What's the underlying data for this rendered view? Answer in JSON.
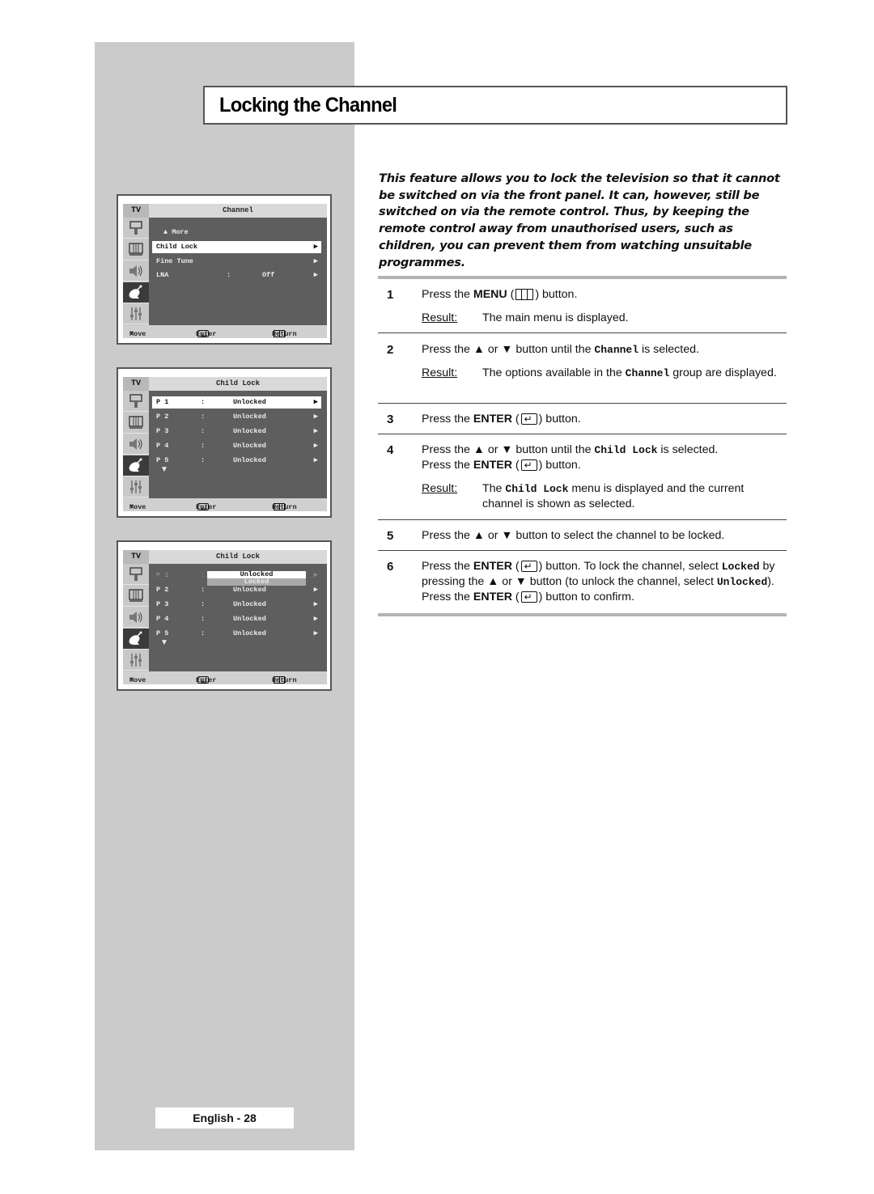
{
  "page": {
    "title": "Locking the Channel",
    "footer": "English - 28",
    "intro": "This feature allows you to lock the television so that it cannot be switched on via the front panel. It can, however, still be switched on via the remote control. Thus, by keeping the remote control away from unauthorised users, such as children, you can prevent them from watching unsuitable programmes."
  },
  "osd_common": {
    "tv_label": "TV",
    "footer_move": "Move",
    "footer_enter": "Enter",
    "footer_return": "Return",
    "icons": [
      "input-icon",
      "picture-icon",
      "sound-icon",
      "channel-icon",
      "setup-icon"
    ],
    "active_icon_index": 3
  },
  "osd_screens": [
    {
      "header": "Channel",
      "more_label": "More",
      "rows": [
        {
          "label": "Child Lock",
          "sep": "",
          "value": "",
          "state": "selected"
        },
        {
          "label": "Fine Tune",
          "sep": "",
          "value": "",
          "state": "normal"
        },
        {
          "label": "LNA",
          "sep": ":",
          "value": "Off",
          "state": "normal"
        }
      ]
    },
    {
      "header": "Child Lock",
      "rows": [
        {
          "label": "P 1",
          "sep": ":",
          "value": "Unlocked",
          "state": "selected"
        },
        {
          "label": "P 2",
          "sep": ":",
          "value": "Unlocked",
          "state": "normal"
        },
        {
          "label": "P 3",
          "sep": ":",
          "value": "Unlocked",
          "state": "normal"
        },
        {
          "label": "P 4",
          "sep": ":",
          "value": "Unlocked",
          "state": "normal"
        },
        {
          "label": "P 5",
          "sep": ":",
          "value": "Unlocked",
          "state": "normal"
        }
      ]
    },
    {
      "header": "Child Lock",
      "rows": [
        {
          "label": "P 1",
          "sep": ":",
          "value": "",
          "state": "dim"
        },
        {
          "label": "P 2",
          "sep": ":",
          "value": "Unlocked",
          "state": "normal"
        },
        {
          "label": "P 3",
          "sep": ":",
          "value": "Unlocked",
          "state": "normal"
        },
        {
          "label": "P 4",
          "sep": ":",
          "value": "Unlocked",
          "state": "normal"
        },
        {
          "label": "P 5",
          "sep": ":",
          "value": "Unlocked",
          "state": "normal"
        }
      ],
      "popup_options": [
        "Unlocked",
        "Locked"
      ],
      "popup_selected": "Unlocked"
    }
  ],
  "steps": [
    {
      "num": "1",
      "parts": [
        "Press the ",
        "MENU",
        " (",
        "menu-icon",
        ")  button."
      ],
      "result": "The main menu is displayed."
    },
    {
      "num": "2",
      "parts": [
        "Press the ▲ or ▼ button until the ",
        "Channel",
        " is selected."
      ],
      "result_parts": [
        "The options available in the ",
        "Channel",
        " group are displayed."
      ]
    },
    {
      "num": "3",
      "parts": [
        "Press the ",
        "ENTER",
        " (",
        "enter-icon",
        ") button."
      ]
    },
    {
      "num": "4",
      "parts": [
        "Press the ▲ or ▼ button until the ",
        "Child Lock",
        " is selected.",
        "Press the ",
        "ENTER",
        " (",
        "enter-icon",
        ") button."
      ],
      "result_parts": [
        "The ",
        "Child Lock",
        " menu is displayed and the current channel is shown as selected."
      ]
    },
    {
      "num": "5",
      "parts": [
        "Press the ▲ or ▼ button to select the channel to be locked."
      ]
    },
    {
      "num": "6",
      "parts": [
        "Press the ",
        "ENTER",
        " (",
        "enter-icon",
        ") button. To lock the channel, select ",
        "Locked",
        " by pressing the ▲ or ▼ button (to unlock the channel, select ",
        "Unlocked",
        "). Press the ",
        "ENTER",
        " (",
        "enter-icon",
        ") button to confirm."
      ]
    }
  ],
  "result_label": "Result:",
  "glyphs": {
    "up": "▲",
    "down": "▼",
    "right": "▶",
    "updown": "⬍"
  }
}
